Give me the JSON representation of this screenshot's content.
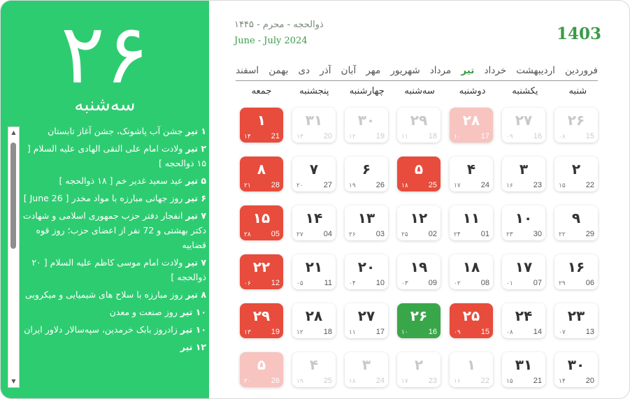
{
  "left": {
    "day_number": "۲۶",
    "weekday": "سه‌شنبه",
    "events": [
      {
        "day": "۱ تیر",
        "text": "جشن آب پاشونک، جشن آغاز تابستان"
      },
      {
        "day": "۲ تیر",
        "text": "ولادت امام علی النقی الهادی علیه السلام [ ۱۵ ذوالحجه ]"
      },
      {
        "day": "۵ تیر",
        "text": "عید سعید غدیر خم [ ۱۸ ذوالحجه ]"
      },
      {
        "day": "۶ تیر",
        "text": "روز جهانی مبارزه با مواد مخدر [ June 26 ]"
      },
      {
        "day": "۷ تیر",
        "text": "انفجار دفتر حزب جمهوری اسلامی و شهادت دکتر بهشتی و 72 نفر از اعضای حزب؛ روز قوه قضاییه"
      },
      {
        "day": "۷ تیر",
        "text": "ولادت امام موسی کاظم علیه السلام [ ۲۰ ذوالحجه ]"
      },
      {
        "day": "۸ تیر",
        "text": "روز مبارزه با سلاح های شیمیایی و میکروبی"
      },
      {
        "day": "۱۰ تیر",
        "text": "روز صنعت و معدن"
      },
      {
        "day": "۱۰ تیر",
        "text": "زادروز بابک خرمدین، سپه‌سالار دلاور ایران"
      },
      {
        "day": "۱۲ تیر",
        "text": ""
      }
    ],
    "scroll_up": "▲",
    "scroll_down": "▼"
  },
  "header": {
    "year": "1403",
    "hijri_months": "ذوالحجه - محرم - ۱۴۴۵",
    "gregorian_months": "June - July 2024"
  },
  "months": [
    "فروردین",
    "اردیبهشت",
    "خرداد",
    "تیر",
    "مرداد",
    "شهریور",
    "مهر",
    "آبان",
    "آذر",
    "دی",
    "بهمن",
    "اسفند"
  ],
  "active_month_index": 3,
  "weekdays": [
    "شنبه",
    "یکشنبه",
    "دوشنبه",
    "سه‌شنبه",
    "چهارشنبه",
    "پنجشنبه",
    "جمعه"
  ],
  "weeks": [
    [
      {
        "p": "۲۶",
        "g": "15",
        "h": "۰۸",
        "type": "out"
      },
      {
        "p": "۲۷",
        "g": "16",
        "h": "۰۹",
        "type": "out"
      },
      {
        "p": "۲۸",
        "g": "17",
        "h": "۱۰",
        "type": "out-holiday"
      },
      {
        "p": "۲۹",
        "g": "18",
        "h": "۱۱",
        "type": "out"
      },
      {
        "p": "۳۰",
        "g": "19",
        "h": "۱۲",
        "type": "out"
      },
      {
        "p": "۳۱",
        "g": "20",
        "h": "۱۳",
        "type": "out"
      },
      {
        "p": "۱",
        "g": "21",
        "h": "۱۴",
        "type": "holiday"
      }
    ],
    [
      {
        "p": "۲",
        "g": "22",
        "h": "۱۵",
        "type": "normal"
      },
      {
        "p": "۳",
        "g": "23",
        "h": "۱۶",
        "type": "normal"
      },
      {
        "p": "۴",
        "g": "24",
        "h": "۱۷",
        "type": "normal"
      },
      {
        "p": "۵",
        "g": "25",
        "h": "۱۸",
        "type": "holiday"
      },
      {
        "p": "۶",
        "g": "26",
        "h": "۱۹",
        "type": "normal"
      },
      {
        "p": "۷",
        "g": "27",
        "h": "۲۰",
        "type": "normal"
      },
      {
        "p": "۸",
        "g": "28",
        "h": "۲۱",
        "type": "holiday"
      }
    ],
    [
      {
        "p": "۹",
        "g": "29",
        "h": "۲۲",
        "type": "normal"
      },
      {
        "p": "۱۰",
        "g": "30",
        "h": "۲۳",
        "type": "normal"
      },
      {
        "p": "۱۱",
        "g": "01",
        "h": "۲۴",
        "type": "normal"
      },
      {
        "p": "۱۲",
        "g": "02",
        "h": "۲۵",
        "type": "normal"
      },
      {
        "p": "۱۳",
        "g": "03",
        "h": "۲۶",
        "type": "normal"
      },
      {
        "p": "۱۴",
        "g": "04",
        "h": "۲۷",
        "type": "normal"
      },
      {
        "p": "۱۵",
        "g": "05",
        "h": "۲۸",
        "type": "holiday"
      }
    ],
    [
      {
        "p": "۱۶",
        "g": "06",
        "h": "۲۹",
        "type": "normal"
      },
      {
        "p": "۱۷",
        "g": "07",
        "h": "۰۱",
        "type": "normal"
      },
      {
        "p": "۱۸",
        "g": "08",
        "h": "۰۲",
        "type": "normal"
      },
      {
        "p": "۱۹",
        "g": "09",
        "h": "۰۳",
        "type": "normal"
      },
      {
        "p": "۲۰",
        "g": "10",
        "h": "۰۴",
        "type": "normal"
      },
      {
        "p": "۲۱",
        "g": "11",
        "h": "۰۵",
        "type": "normal"
      },
      {
        "p": "۲۲",
        "g": "12",
        "h": "۰۶",
        "type": "holiday"
      }
    ],
    [
      {
        "p": "۲۳",
        "g": "13",
        "h": "۰۷",
        "type": "normal"
      },
      {
        "p": "۲۴",
        "g": "14",
        "h": "۰۸",
        "type": "normal"
      },
      {
        "p": "۲۵",
        "g": "15",
        "h": "۰۹",
        "type": "holiday"
      },
      {
        "p": "۲۶",
        "g": "16",
        "h": "۱۰",
        "type": "today"
      },
      {
        "p": "۲۷",
        "g": "17",
        "h": "۱۱",
        "type": "normal"
      },
      {
        "p": "۲۸",
        "g": "18",
        "h": "۱۲",
        "type": "normal"
      },
      {
        "p": "۲۹",
        "g": "19",
        "h": "۱۳",
        "type": "holiday"
      }
    ],
    [
      {
        "p": "۳۰",
        "g": "20",
        "h": "۱۴",
        "type": "normal"
      },
      {
        "p": "۳۱",
        "g": "21",
        "h": "۱۵",
        "type": "normal"
      },
      {
        "p": "۱",
        "g": "22",
        "h": "۱۶",
        "type": "out"
      },
      {
        "p": "۲",
        "g": "23",
        "h": "۱۷",
        "type": "out"
      },
      {
        "p": "۳",
        "g": "24",
        "h": "۱۸",
        "type": "out"
      },
      {
        "p": "۴",
        "g": "25",
        "h": "۱۹",
        "type": "out"
      },
      {
        "p": "۵",
        "g": "26",
        "h": "۲۰",
        "type": "out-holiday"
      }
    ]
  ],
  "colors": {
    "green_panel": "#2ecc71",
    "holiday": "#e74c3c",
    "today": "#3aa64a",
    "accent": "#3a9b48"
  }
}
